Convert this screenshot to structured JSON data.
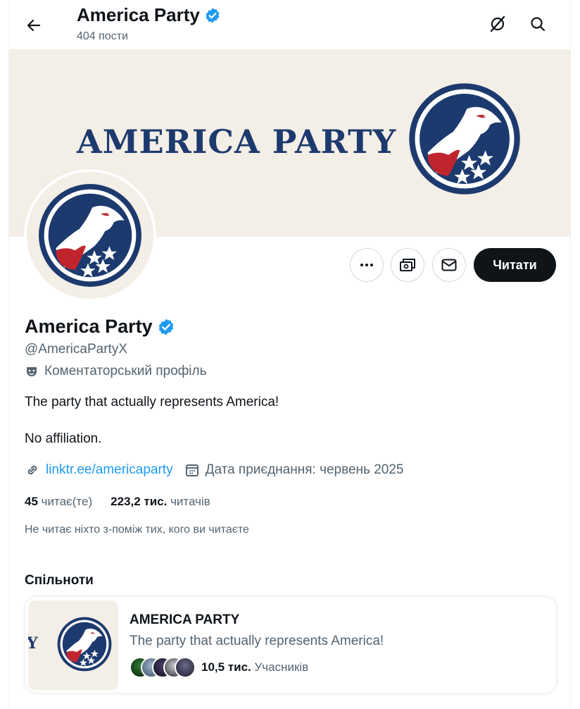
{
  "header": {
    "title": "America Party",
    "posts_count": "404 пости"
  },
  "banner": {
    "text": "AMERICA PARTY"
  },
  "actions": {
    "follow_label": "Читати"
  },
  "profile": {
    "name": "America Party",
    "handle": "@AmericaPartyX",
    "label": "Коментаторський профіль",
    "bio_line1": "The party that actually represents America!",
    "bio_line2": "No affiliation.",
    "link": "linktr.ee/americaparty",
    "joined": "Дата приєднання: червень 2025",
    "following_count": "45",
    "following_label": "читає(те)",
    "followers_count": "223,2 тис.",
    "followers_label": "читачів",
    "no_mutual": "Не читає ніхто з-поміж тих, кого ви читаєте"
  },
  "communities": {
    "section_title": "Спільноти",
    "items": [
      {
        "name": "AMERICA PARTY",
        "description": "The party that actually represents America!",
        "members_count": "10,5 тис.",
        "members_label": "Учасників"
      }
    ]
  },
  "colors": {
    "verified": "#1d9bf0",
    "navy": "#1d3a6e",
    "red": "#c0252d",
    "follow_button": "#0f1419",
    "link": "#1d9bf0"
  },
  "icons": [
    "back-arrow-icon",
    "grok-icon",
    "search-icon",
    "verified-badge-icon",
    "more-icon",
    "subscribe-icon",
    "message-icon",
    "parody-mask-icon",
    "link-icon",
    "calendar-icon"
  ]
}
